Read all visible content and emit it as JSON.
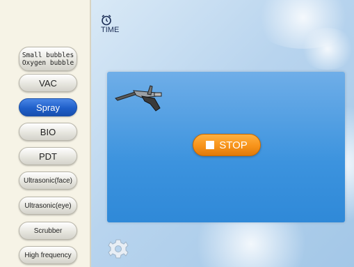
{
  "sidebar": {
    "bubble_line1": "Small bubbles",
    "bubble_line2": "Oxygen bubble",
    "items": [
      {
        "label": "VAC"
      },
      {
        "label": "Spray"
      },
      {
        "label": "BIO"
      },
      {
        "label": "PDT"
      },
      {
        "label": "Ultrasonic(face)"
      },
      {
        "label": "Ultrasonic(eye)"
      },
      {
        "label": "Scrubber"
      },
      {
        "label": "High frequency"
      }
    ],
    "active_item": "Spray"
  },
  "time": {
    "label": "TIME",
    "icon": "alarm-clock-icon"
  },
  "panel": {
    "tool_icon": "spray-gun-icon",
    "stop_label": "STOP",
    "stop_icon": "stop-square-icon"
  },
  "settings": {
    "icon": "gear-icon"
  },
  "colors": {
    "accent_active": "#1f5fc9",
    "stop_button": "#f7931a",
    "panel": "#3c93de",
    "sidebar_bg": "#f6f3e6"
  }
}
